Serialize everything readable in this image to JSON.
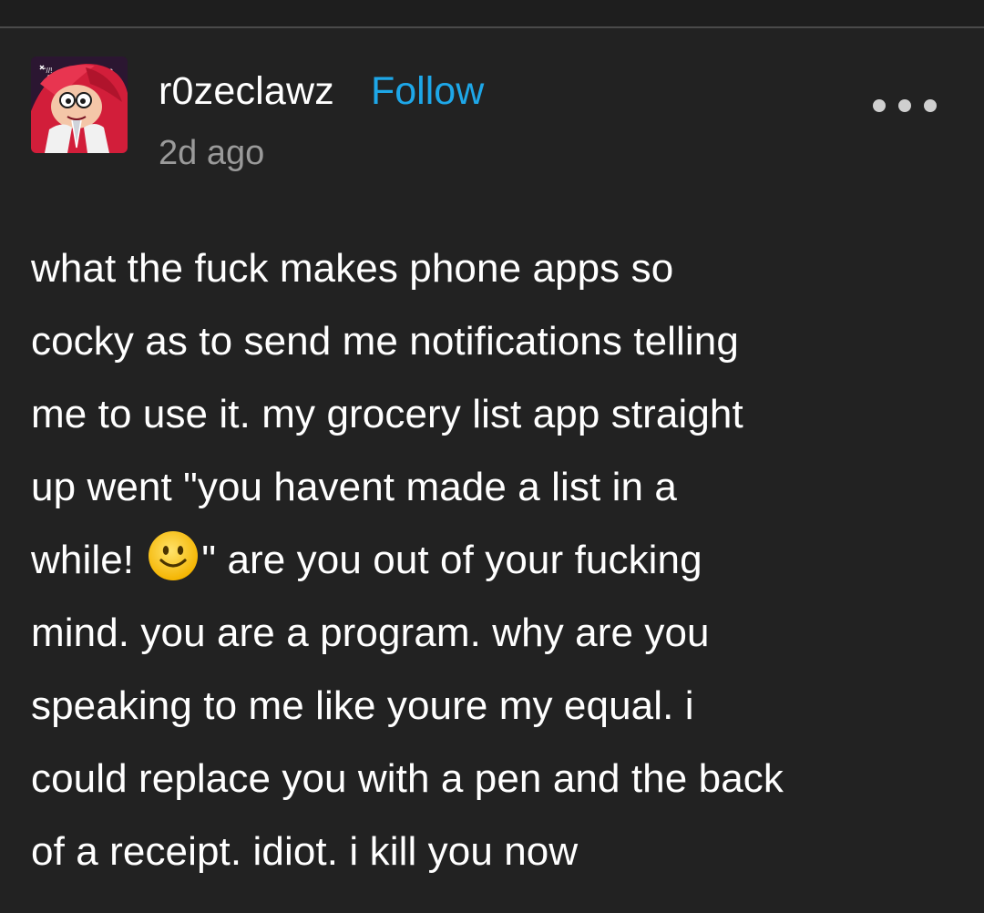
{
  "post": {
    "username": "r0zeclawz",
    "follow_label": "Follow",
    "timestamp": "2d ago",
    "body_lines": [
      "what the fuck makes phone apps so",
      "cocky as to send me notifications telling",
      "me to use it. my grocery list app straight",
      "up went \"you havent made a list in a",
      "while! ",
      "\" are you out of your fucking",
      "mind. you are a program. why are you",
      "speaking to me like youre my equal. i",
      "could replace you with a pen and the back",
      "of a receipt. idiot. i kill you now"
    ],
    "emoji": "slightly-smiling-face",
    "menu_icon": "more-horizontal-icon"
  },
  "colors": {
    "background": "#222222",
    "text": "#ffffff",
    "follow": "#1ea7e8",
    "timestamp": "#9a9a9a"
  }
}
